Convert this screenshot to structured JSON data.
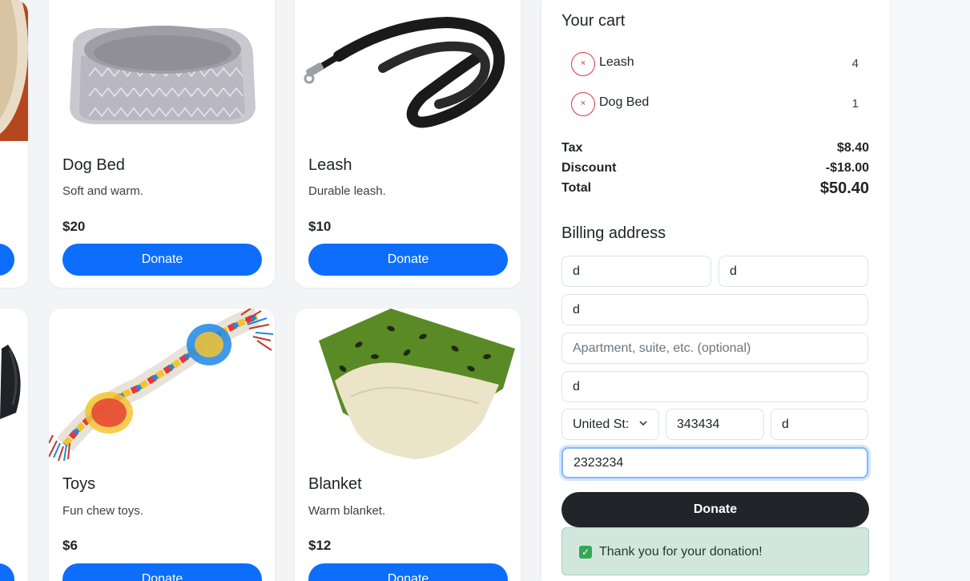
{
  "products": [
    {
      "name": "Dog Bed",
      "description": "Soft and warm.",
      "price": "$20",
      "button": "Donate"
    },
    {
      "name": "Leash",
      "description": "Durable leash.",
      "price": "$10",
      "button": "Donate"
    },
    {
      "name": "Toys",
      "description": "Fun chew toys.",
      "price": "$6",
      "button": "Donate"
    },
    {
      "name": "Blanket",
      "description": "Warm blanket.",
      "price": "$12",
      "button": "Donate"
    }
  ],
  "cart": {
    "title": "Your cart",
    "items": [
      {
        "name": "Leash",
        "qty": "4",
        "remove": "×"
      },
      {
        "name": "Dog Bed",
        "qty": "1",
        "remove": "×"
      }
    ],
    "tax_label": "Tax",
    "tax": "$8.40",
    "discount_label": "Discount",
    "discount": "-$18.00",
    "total_label": "Total",
    "total": "$50.40"
  },
  "billing": {
    "title": "Billing address",
    "first_name": "d",
    "last_name": "d",
    "address": "d",
    "address2_placeholder": "Apartment, suite, etc. (optional)",
    "city": "d",
    "country": "United St:",
    "zip": "343434",
    "state": "d",
    "phone": "2323234",
    "submit": "Donate"
  },
  "alert": {
    "check": "✓",
    "message": "Thank you for your donation!"
  },
  "colors": {
    "primary": "#0d6efd",
    "dark": "#212529",
    "danger": "#dc3545",
    "success_bg": "#d1e7dd"
  }
}
